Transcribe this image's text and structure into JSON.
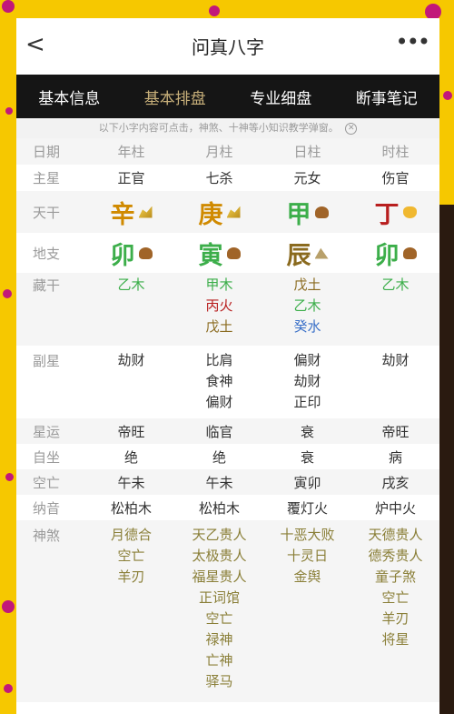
{
  "nav": {
    "back_icon": "<",
    "title": "问真八字",
    "more_icon": "•••"
  },
  "tabs": [
    {
      "label": "基本信息"
    },
    {
      "label": "基本排盘"
    },
    {
      "label": "专业细盘"
    },
    {
      "label": "断事笔记"
    }
  ],
  "notice": "以下小字内容可点击，神煞、十神等小知识教学弹窗。",
  "table": {
    "header": {
      "label": "日期",
      "cols": [
        "年柱",
        "月柱",
        "日柱",
        "时柱"
      ]
    },
    "zhuxing": {
      "label": "主星",
      "values": [
        "正官",
        "七杀",
        "元女",
        "伤官"
      ]
    },
    "tiangan": {
      "label": "天干",
      "values": [
        "辛",
        "庚",
        "甲",
        "丁"
      ]
    },
    "dizhi": {
      "label": "地支",
      "values": [
        "卯",
        "寅",
        "辰",
        "卯"
      ]
    },
    "canggan": {
      "label": "藏干",
      "values": [
        [
          "乙木"
        ],
        [
          "甲木",
          "丙火",
          "戊土"
        ],
        [
          "戊土",
          "乙木",
          "癸水"
        ],
        [
          "乙木"
        ]
      ]
    },
    "fuxing": {
      "label": "副星",
      "values": [
        [
          "劫财"
        ],
        [
          "比肩",
          "食神",
          "偏财"
        ],
        [
          "偏财",
          "劫财",
          "正印"
        ],
        [
          "劫财"
        ]
      ]
    },
    "xingyun": {
      "label": "星运",
      "values": [
        "帝旺",
        "临官",
        "衰",
        "帝旺"
      ]
    },
    "zizuo": {
      "label": "自坐",
      "values": [
        "绝",
        "绝",
        "衰",
        "病"
      ]
    },
    "kongwang": {
      "label": "空亡",
      "values": [
        "午未",
        "午未",
        "寅卯",
        "戌亥"
      ]
    },
    "nayin": {
      "label": "纳音",
      "values": [
        "松柏木",
        "松柏木",
        "覆灯火",
        "炉中火"
      ]
    },
    "shensha": {
      "label": "神煞",
      "values": [
        [
          "月德合",
          "空亡",
          "羊刃"
        ],
        [
          "天乙贵人",
          "太极贵人",
          "福星贵人",
          "正词馆",
          "空亡",
          "禄神",
          "亡神",
          "驿马"
        ],
        [
          "十恶大败",
          "十灵日",
          "金舆"
        ],
        [
          "天德贵人",
          "德秀贵人",
          "童子煞",
          "空亡",
          "羊刃",
          "将星"
        ]
      ]
    }
  },
  "colors": {
    "wood": "#3cae4a",
    "fire": "#b81e1e",
    "earth": "#8a6a1e",
    "water": "#3a70c8",
    "metal": "#d08a00",
    "tab_bar": "#151515",
    "tab_active": "#c8b07a",
    "frame": "#f6c800"
  }
}
